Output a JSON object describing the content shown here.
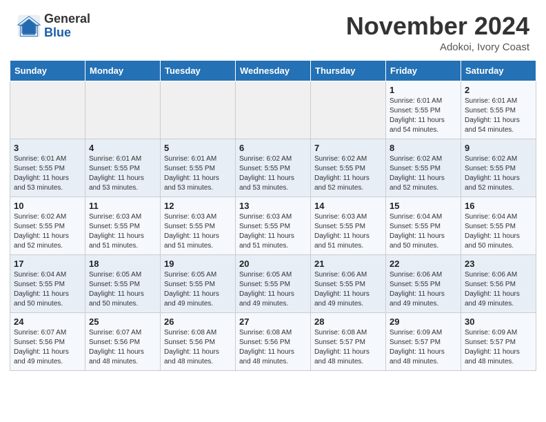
{
  "header": {
    "logo_general": "General",
    "logo_blue": "Blue",
    "month": "November 2024",
    "location": "Adokoi, Ivory Coast"
  },
  "weekdays": [
    "Sunday",
    "Monday",
    "Tuesday",
    "Wednesday",
    "Thursday",
    "Friday",
    "Saturday"
  ],
  "weeks": [
    [
      {
        "day": "",
        "info": ""
      },
      {
        "day": "",
        "info": ""
      },
      {
        "day": "",
        "info": ""
      },
      {
        "day": "",
        "info": ""
      },
      {
        "day": "",
        "info": ""
      },
      {
        "day": "1",
        "info": "Sunrise: 6:01 AM\nSunset: 5:55 PM\nDaylight: 11 hours\nand 54 minutes."
      },
      {
        "day": "2",
        "info": "Sunrise: 6:01 AM\nSunset: 5:55 PM\nDaylight: 11 hours\nand 54 minutes."
      }
    ],
    [
      {
        "day": "3",
        "info": "Sunrise: 6:01 AM\nSunset: 5:55 PM\nDaylight: 11 hours\nand 53 minutes."
      },
      {
        "day": "4",
        "info": "Sunrise: 6:01 AM\nSunset: 5:55 PM\nDaylight: 11 hours\nand 53 minutes."
      },
      {
        "day": "5",
        "info": "Sunrise: 6:01 AM\nSunset: 5:55 PM\nDaylight: 11 hours\nand 53 minutes."
      },
      {
        "day": "6",
        "info": "Sunrise: 6:02 AM\nSunset: 5:55 PM\nDaylight: 11 hours\nand 53 minutes."
      },
      {
        "day": "7",
        "info": "Sunrise: 6:02 AM\nSunset: 5:55 PM\nDaylight: 11 hours\nand 52 minutes."
      },
      {
        "day": "8",
        "info": "Sunrise: 6:02 AM\nSunset: 5:55 PM\nDaylight: 11 hours\nand 52 minutes."
      },
      {
        "day": "9",
        "info": "Sunrise: 6:02 AM\nSunset: 5:55 PM\nDaylight: 11 hours\nand 52 minutes."
      }
    ],
    [
      {
        "day": "10",
        "info": "Sunrise: 6:02 AM\nSunset: 5:55 PM\nDaylight: 11 hours\nand 52 minutes."
      },
      {
        "day": "11",
        "info": "Sunrise: 6:03 AM\nSunset: 5:55 PM\nDaylight: 11 hours\nand 51 minutes."
      },
      {
        "day": "12",
        "info": "Sunrise: 6:03 AM\nSunset: 5:55 PM\nDaylight: 11 hours\nand 51 minutes."
      },
      {
        "day": "13",
        "info": "Sunrise: 6:03 AM\nSunset: 5:55 PM\nDaylight: 11 hours\nand 51 minutes."
      },
      {
        "day": "14",
        "info": "Sunrise: 6:03 AM\nSunset: 5:55 PM\nDaylight: 11 hours\nand 51 minutes."
      },
      {
        "day": "15",
        "info": "Sunrise: 6:04 AM\nSunset: 5:55 PM\nDaylight: 11 hours\nand 50 minutes."
      },
      {
        "day": "16",
        "info": "Sunrise: 6:04 AM\nSunset: 5:55 PM\nDaylight: 11 hours\nand 50 minutes."
      }
    ],
    [
      {
        "day": "17",
        "info": "Sunrise: 6:04 AM\nSunset: 5:55 PM\nDaylight: 11 hours\nand 50 minutes."
      },
      {
        "day": "18",
        "info": "Sunrise: 6:05 AM\nSunset: 5:55 PM\nDaylight: 11 hours\nand 50 minutes."
      },
      {
        "day": "19",
        "info": "Sunrise: 6:05 AM\nSunset: 5:55 PM\nDaylight: 11 hours\nand 49 minutes."
      },
      {
        "day": "20",
        "info": "Sunrise: 6:05 AM\nSunset: 5:55 PM\nDaylight: 11 hours\nand 49 minutes."
      },
      {
        "day": "21",
        "info": "Sunrise: 6:06 AM\nSunset: 5:55 PM\nDaylight: 11 hours\nand 49 minutes."
      },
      {
        "day": "22",
        "info": "Sunrise: 6:06 AM\nSunset: 5:55 PM\nDaylight: 11 hours\nand 49 minutes."
      },
      {
        "day": "23",
        "info": "Sunrise: 6:06 AM\nSunset: 5:56 PM\nDaylight: 11 hours\nand 49 minutes."
      }
    ],
    [
      {
        "day": "24",
        "info": "Sunrise: 6:07 AM\nSunset: 5:56 PM\nDaylight: 11 hours\nand 49 minutes."
      },
      {
        "day": "25",
        "info": "Sunrise: 6:07 AM\nSunset: 5:56 PM\nDaylight: 11 hours\nand 48 minutes."
      },
      {
        "day": "26",
        "info": "Sunrise: 6:08 AM\nSunset: 5:56 PM\nDaylight: 11 hours\nand 48 minutes."
      },
      {
        "day": "27",
        "info": "Sunrise: 6:08 AM\nSunset: 5:56 PM\nDaylight: 11 hours\nand 48 minutes."
      },
      {
        "day": "28",
        "info": "Sunrise: 6:08 AM\nSunset: 5:57 PM\nDaylight: 11 hours\nand 48 minutes."
      },
      {
        "day": "29",
        "info": "Sunrise: 6:09 AM\nSunset: 5:57 PM\nDaylight: 11 hours\nand 48 minutes."
      },
      {
        "day": "30",
        "info": "Sunrise: 6:09 AM\nSunset: 5:57 PM\nDaylight: 11 hours\nand 48 minutes."
      }
    ]
  ]
}
